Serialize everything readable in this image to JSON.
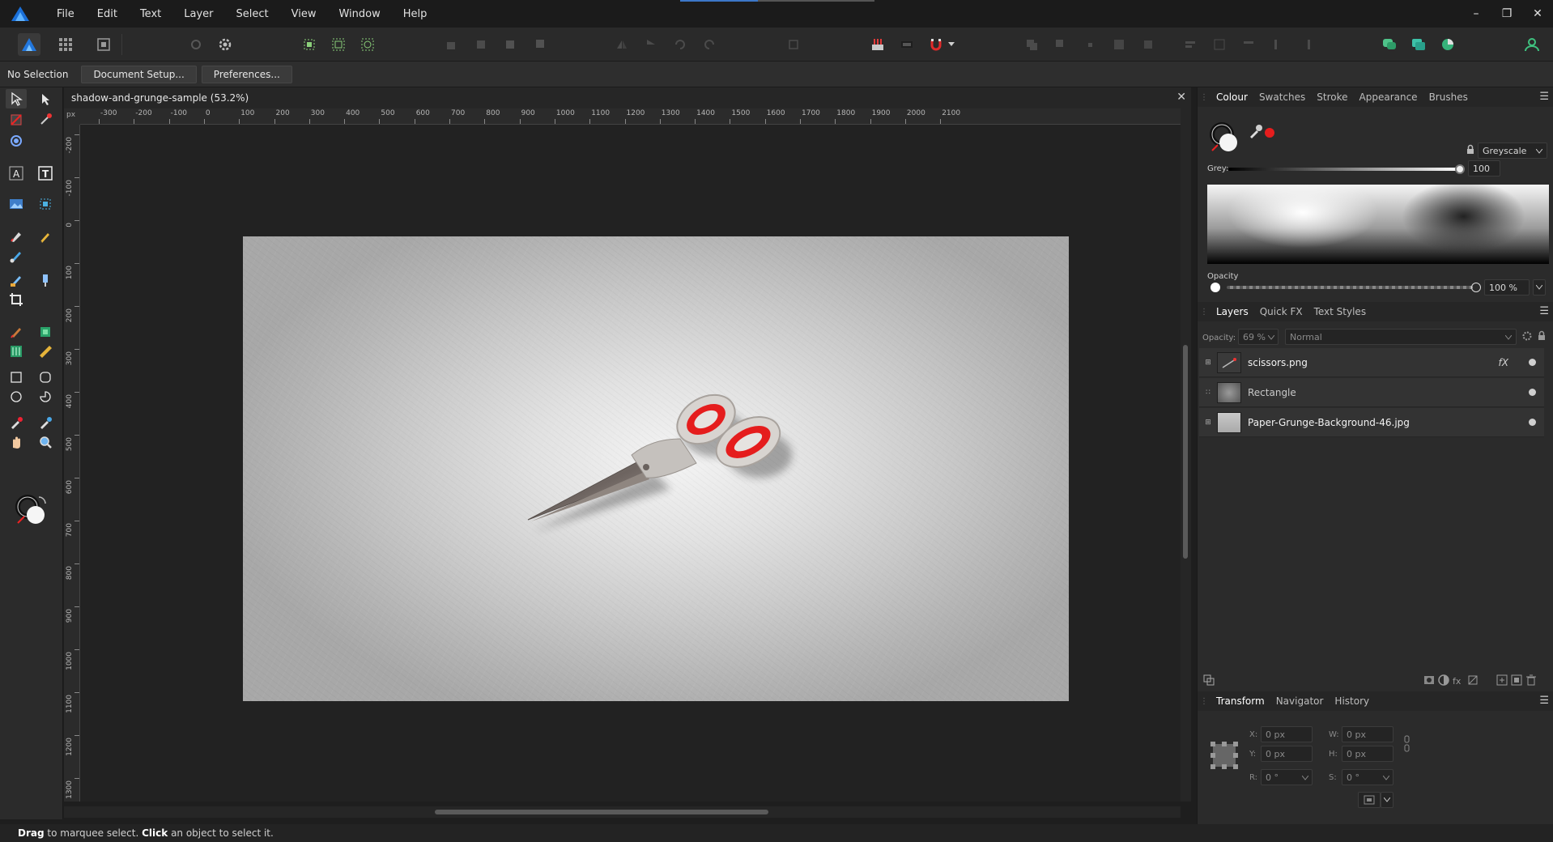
{
  "app": {
    "menu": [
      "File",
      "Edit",
      "Text",
      "Layer",
      "Select",
      "View",
      "Window",
      "Help"
    ],
    "window_controls": {
      "minimize": "–",
      "restore": "❐",
      "close": "✕"
    },
    "load_progress": 0.4
  },
  "context_bar": {
    "selection_label": "No Selection",
    "document_setup": "Document Setup...",
    "preferences": "Preferences..."
  },
  "document": {
    "tab_title": "shadow-and-grunge-sample (53.2%)",
    "close": "✕",
    "ruler_unit": "px",
    "ruler_h_labels": [
      "-300",
      "-200",
      "-100",
      "0",
      "100",
      "200",
      "300",
      "400",
      "500",
      "600",
      "700",
      "800",
      "900",
      "1000",
      "1100",
      "1200",
      "1300",
      "1400",
      "1500",
      "1600",
      "1700",
      "1800",
      "1900",
      "2000",
      "2100"
    ],
    "ruler_v_labels": [
      "-200",
      "-100",
      "0",
      "100",
      "200",
      "300",
      "400",
      "500",
      "600",
      "700",
      "800",
      "900",
      "1000",
      "1100",
      "1200",
      "1300"
    ]
  },
  "status": {
    "drag": "Drag",
    "drag_text": " to marquee select. ",
    "click": "Click",
    "click_text": " an object to select it."
  },
  "colour_panel": {
    "tabs": [
      "Colour",
      "Swatches",
      "Stroke",
      "Appearance",
      "Brushes"
    ],
    "active_tab": "Colour",
    "mode": "Greyscale",
    "grey_label": "Grey:",
    "grey_value": "100",
    "opacity_label": "Opacity",
    "opacity_value": "100 %",
    "accent": "#e51d1d"
  },
  "layers_panel": {
    "tabs": [
      "Layers",
      "Quick FX",
      "Text Styles"
    ],
    "active_tab": "Layers",
    "opacity_label": "Opacity:",
    "opacity_value": "69 %",
    "blend_mode": "Normal",
    "items": [
      {
        "name": "scissors.png",
        "fx": "fX"
      },
      {
        "name": "Rectangle"
      },
      {
        "name": "Paper-Grunge-Background-46.jpg"
      }
    ]
  },
  "transform_panel": {
    "tabs": [
      "Transform",
      "Navigator",
      "History"
    ],
    "active_tab": "Transform",
    "x_label": "X:",
    "x": "0 px",
    "y_label": "Y:",
    "y": "0 px",
    "w_label": "W:",
    "w": "0 px",
    "h_label": "H:",
    "h": "0 px",
    "r_label": "R:",
    "r": "0 °",
    "s_label": "S:",
    "s": "0 °"
  }
}
